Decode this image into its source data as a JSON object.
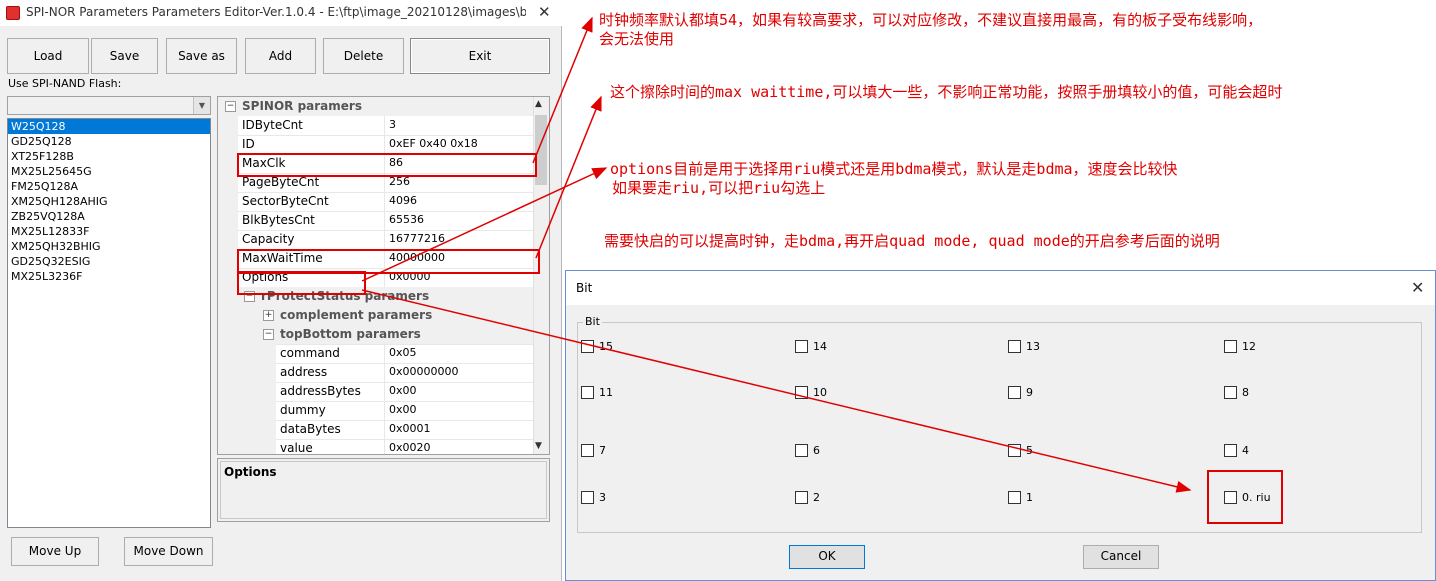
{
  "window": {
    "title": "SPI-NOR Parameters Parameters Editor-Ver.1.0.4 - E:\\ftp\\image_20210128\\images\\b...",
    "close_glyph": "✕"
  },
  "toolbar": {
    "load": "Load",
    "save": "Save",
    "save_as": "Save as",
    "add": "Add",
    "delete": "Delete",
    "exit": "Exit"
  },
  "flash_list": {
    "label": "Use SPI-NAND Flash:",
    "combo_value": "",
    "items": [
      "W25Q128",
      "GD25Q128",
      "XT25F128B",
      "MX25L25645G",
      "FM25Q128A",
      "XM25QH128AHIG",
      "ZB25VQ128A",
      "MX25L12833F",
      "XM25QH32BHIG",
      "GD25Q32ESIG",
      "MX25L3236F"
    ],
    "selected_index": 0
  },
  "property_grid": {
    "category": "SPINOR paramers",
    "rows": [
      {
        "name": "IDByteCnt",
        "value": "3"
      },
      {
        "name": "ID",
        "value": "0xEF 0x40 0x18"
      },
      {
        "name": "MaxClk",
        "value": "86"
      },
      {
        "name": "PageByteCnt",
        "value": "256"
      },
      {
        "name": "SectorByteCnt",
        "value": "4096"
      },
      {
        "name": "BlkBytesCnt",
        "value": "65536"
      },
      {
        "name": "Capacity",
        "value": "16777216"
      },
      {
        "name": "MaxWaitTime",
        "value": "40000000"
      },
      {
        "name": "Options",
        "value": "0x0000"
      }
    ],
    "sub_category": "rProtectStatus paramers",
    "complement": "complement paramers",
    "top_bottom": "topBottom paramers",
    "sub_rows": [
      {
        "name": "command",
        "value": "0x05"
      },
      {
        "name": "address",
        "value": "0x00000000"
      },
      {
        "name": "addressBytes",
        "value": "0x00"
      },
      {
        "name": "dummy",
        "value": "0x00"
      },
      {
        "name": "dataBytes",
        "value": "0x0001"
      },
      {
        "name": "value",
        "value": "0x0020"
      }
    ],
    "description_title": "Options"
  },
  "bottom_buttons": {
    "move_up": "Move Up",
    "move_down": "Move Down"
  },
  "bit_dialog": {
    "title": "Bit",
    "group_label": "Bit",
    "checkboxes": [
      "15",
      "14",
      "13",
      "12",
      "11",
      "10",
      "9",
      "8",
      "7",
      "6",
      "5",
      "4",
      "3",
      "2",
      "1",
      "0. riu"
    ],
    "ok": "OK",
    "cancel": "Cancel"
  },
  "annotations": {
    "note_clock_1": "时钟频率默认都填54，如果有较高要求，可以对应修改，不建议直接用最高，有的板子受布线影响，",
    "note_clock_2": "会无法使用",
    "note_wait": "这个擦除时间的max waittime,可以填大一些，不影响正常功能，按照手册填较小的值，可能会超时",
    "note_options_1": "options目前是用于选择用riu模式还是用bdma模式，默认是走bdma，速度会比较快",
    "note_options_2": "如果要走riu,可以把riu勾选上",
    "note_quad": "需要快启的可以提高时钟，走bdma,再开启quad mode, quad mode的开启参考后面的说明",
    "color": "#e00000"
  }
}
